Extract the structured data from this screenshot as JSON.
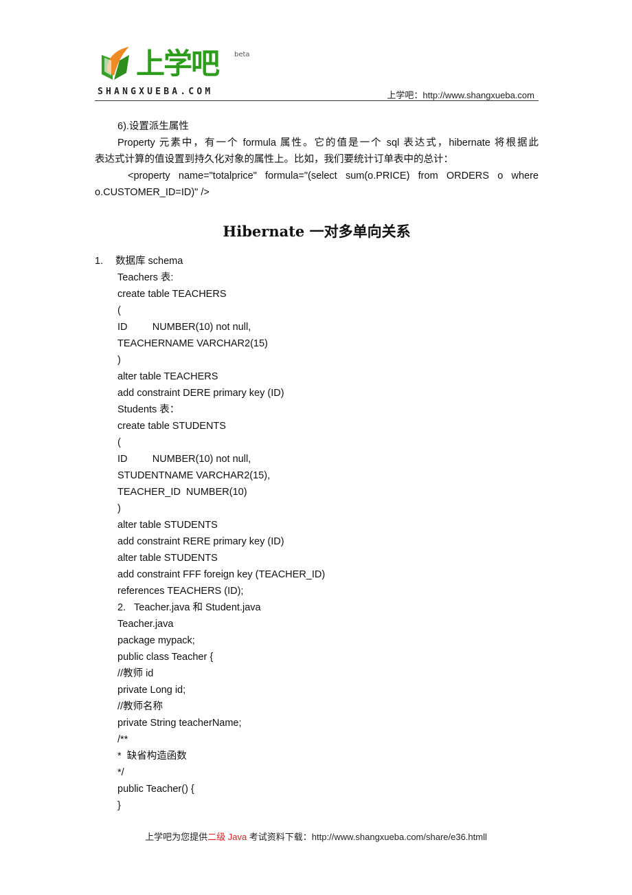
{
  "header": {
    "logo_cn": "上学吧",
    "logo_beta": "beta",
    "logo_en": "SHANGXUEBA.COM",
    "site_link": "上学吧：http://www.shangxueba.com"
  },
  "section_derived": {
    "heading": "6).设置派生属性",
    "para_line1": "Property 元素中，有一个 formula 属性。它的值是一个 sql 表达式，hibernate 将根据此",
    "para_line2": "表达式计算的值设置到持久化对象的属性上。比如，我们要统计订单表中的总计：",
    "code_line1": "<property name=\"totalprice\" formula=\"(select sum(o.PRICE) from ORDERS o where",
    "code_line2": "o.CUSTOMER_ID=ID)\" />"
  },
  "title": "Hibernate 一对多单向关系",
  "list": [
    {
      "num": "1.",
      "label": "数据库 schema",
      "lines": [
        "Teachers 表:",
        "create table TEACHERS",
        "(",
        "ID         NUMBER(10) not null,",
        "TEACHERNAME VARCHAR2(15)",
        ")",
        "alter table TEACHERS",
        "add constraint DERE primary key (ID)",
        "Students 表：",
        "create table STUDENTS",
        "(",
        "ID         NUMBER(10) not null,",
        "STUDENTNAME VARCHAR2(15),",
        "TEACHER_ID  NUMBER(10)",
        ")",
        "alter table STUDENTS",
        "add constraint RERE primary key (ID)",
        "alter table STUDENTS",
        "add constraint FFF foreign key (TEACHER_ID)",
        "references TEACHERS (ID);"
      ]
    },
    {
      "num": "2.",
      "label": "Teacher.java 和 Student.java",
      "lines": [
        "Teacher.java",
        "package mypack;",
        "public class Teacher {",
        "//教师 id",
        "private Long id;",
        "//教师名称",
        "private String teacherName;",
        "/**",
        "*  缺省构造函数",
        "*/",
        "public Teacher() {",
        "}"
      ]
    }
  ],
  "footer": {
    "prefix": "上学吧为您提供",
    "highlight": "二级 Java",
    "suffix": " 考试资料下载：http://www.shangxueba.com/share/e36.htmll",
    "highlight_color": "#e02020"
  }
}
